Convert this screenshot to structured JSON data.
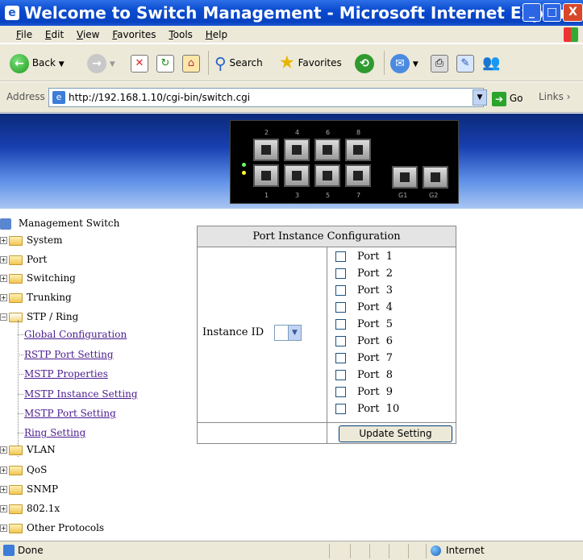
{
  "window": {
    "title": "Welcome to Switch Management - Microsoft Internet Explorer",
    "min_glyph": "_",
    "max_glyph": "□",
    "close_glyph": "X"
  },
  "menu": [
    "File",
    "Edit",
    "View",
    "Favorites",
    "Tools",
    "Help"
  ],
  "toolbar": {
    "back": "Back",
    "search": "Search",
    "favorites": "Favorites"
  },
  "address": {
    "label": "Address",
    "url": "http://192.168.1.10/cgi-bin/switch.cgi",
    "go": "Go",
    "links": "Links"
  },
  "nav": {
    "root": "Management Switch",
    "folders": [
      "System",
      "Port",
      "Switching",
      "Trunking",
      "STP / Ring",
      "VLAN",
      "QoS",
      "SNMP",
      "802.1x",
      "Other Protocols"
    ],
    "stp_children": [
      "Global Configuration",
      "RSTP Port Setting",
      "MSTP Properties",
      "MSTP Instance Setting",
      "MSTP Port Setting",
      "Ring Setting"
    ]
  },
  "config": {
    "title": "Port Instance Configuration",
    "instance_label": "Instance ID",
    "instance_value": "",
    "ports": [
      "Port  1",
      "Port  2",
      "Port  3",
      "Port  4",
      "Port  5",
      "Port  6",
      "Port  7",
      "Port  8",
      "Port  9",
      "Port  10"
    ],
    "update_button": "Update Setting"
  },
  "status": {
    "text": "Done",
    "zone": "Internet"
  },
  "switch_ports": {
    "top_labels": [
      "2",
      "4",
      "6",
      "8"
    ],
    "bottom_labels": [
      "1",
      "3",
      "5",
      "7",
      "G1",
      "G2"
    ]
  }
}
